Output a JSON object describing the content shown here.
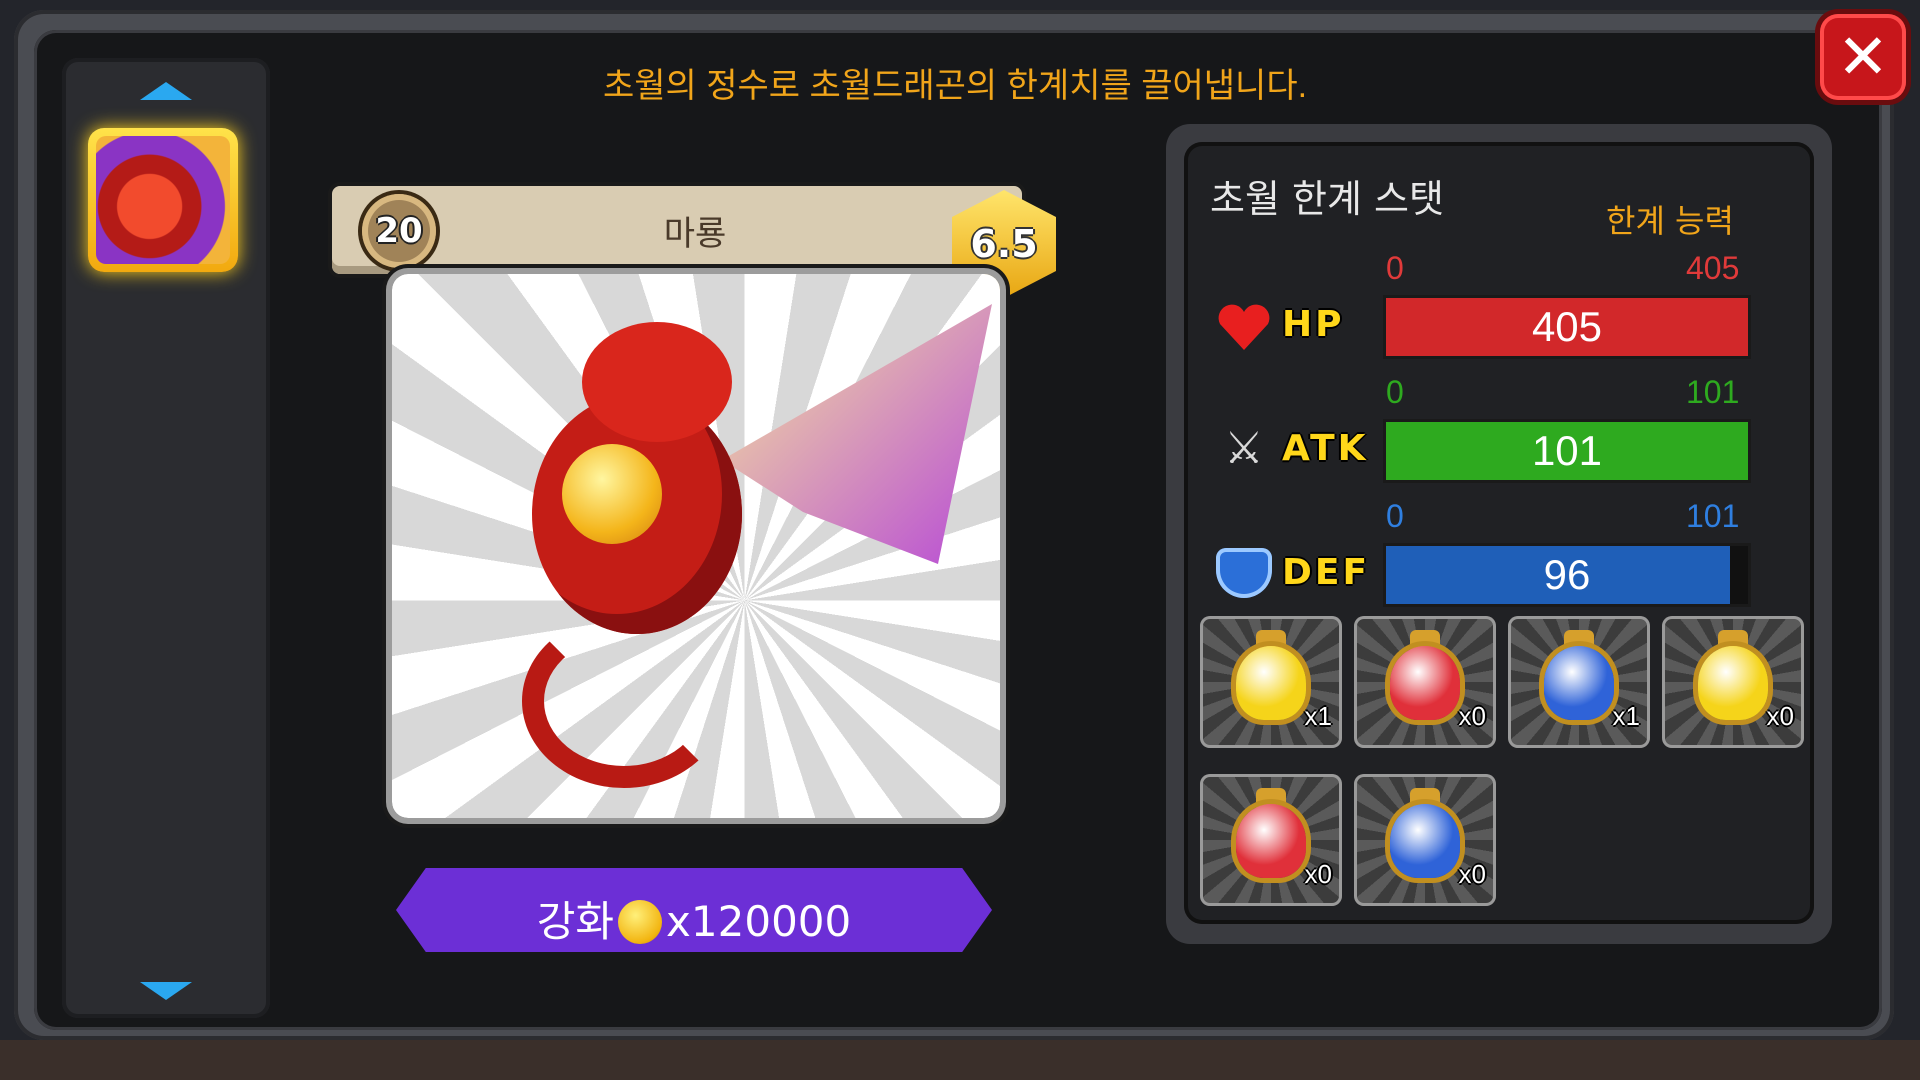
{
  "header": {
    "instruction": "초월의 정수로 초월드래곤의 한계치를 끌어냅니다.",
    "close_icon": "close-icon"
  },
  "character": {
    "level": "20",
    "name": "마룡",
    "grade": "6.5"
  },
  "enhance": {
    "label": "강화",
    "cost": "x120000",
    "coin_icon": "gold-coin-icon"
  },
  "stats": {
    "title": "초월 한계 스탯",
    "subtitle": "한계 능력",
    "hp": {
      "label": "HP",
      "min": "0",
      "max": "405",
      "value": "405",
      "fill": 1.0,
      "color": "#d2282a"
    },
    "atk": {
      "label": "ATK",
      "min": "0",
      "max": "101",
      "value": "101",
      "fill": 1.0,
      "color": "#2eaa1f"
    },
    "def": {
      "label": "DEF",
      "min": "0",
      "max": "101",
      "value": "96",
      "fill": 0.95,
      "color": "#1f5fb8"
    }
  },
  "potions": [
    {
      "name": "yellow-potion-icon",
      "count": "x1",
      "color": "#f5d41a"
    },
    {
      "name": "red-potion-icon",
      "count": "x0",
      "color": "#e0303a"
    },
    {
      "name": "blue-potion-icon",
      "count": "x1",
      "color": "#2f63d8"
    },
    {
      "name": "large-yellow-potion-icon",
      "count": "x0",
      "color": "#f5d41a"
    },
    {
      "name": "large-red-potion-icon",
      "count": "x0",
      "color": "#e0303a"
    },
    {
      "name": "large-blue-potion-icon",
      "count": "x0",
      "color": "#2f63d8"
    }
  ],
  "colors": {
    "accent_orange": "#f1a51a",
    "enhance_purple": "#6c2fd6",
    "scroll_arrow_blue": "#2aa8f0"
  }
}
